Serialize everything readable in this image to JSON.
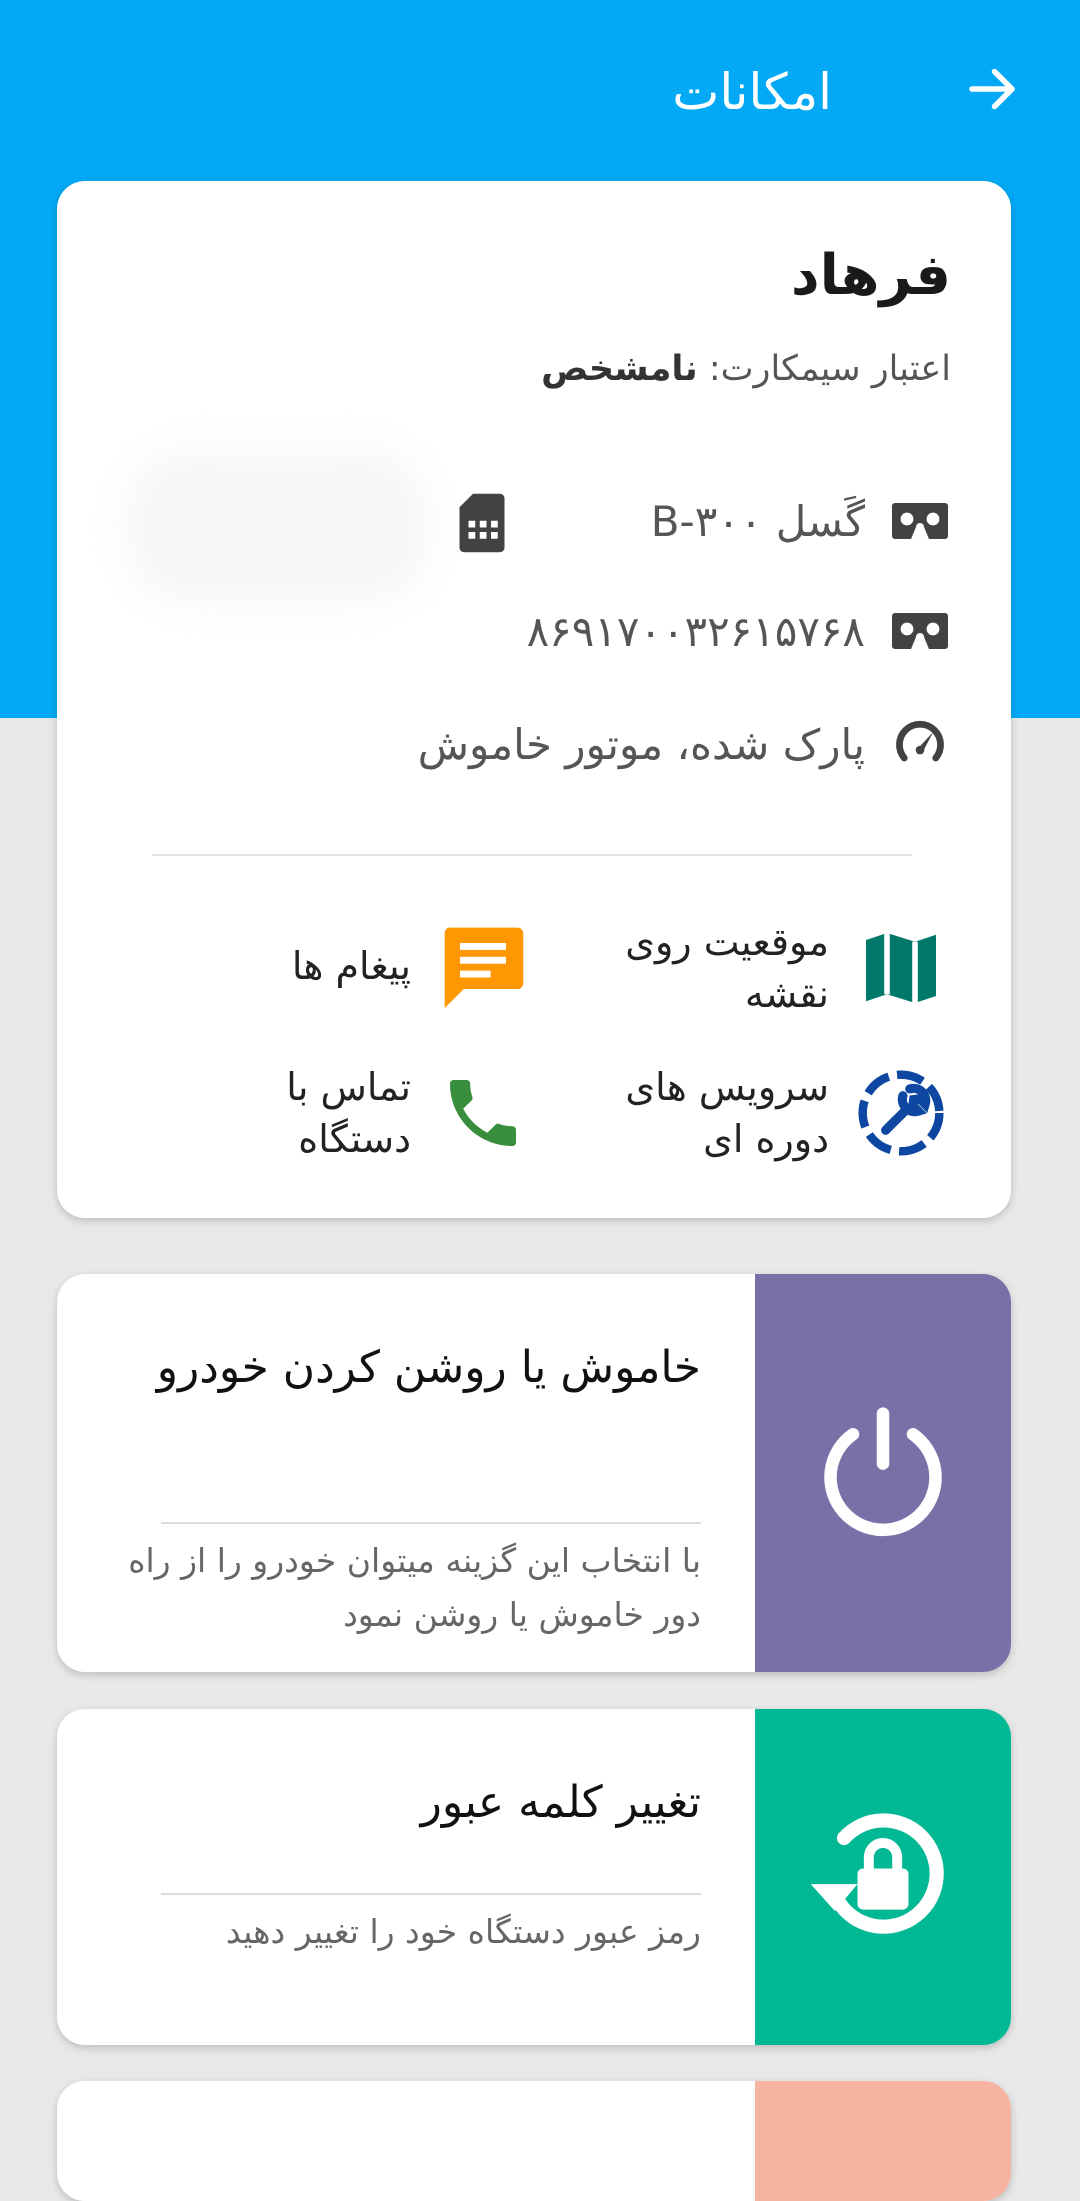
{
  "header": {
    "title": "امکانات"
  },
  "info": {
    "owner": "فرهاد",
    "sim_credit_label": "اعتبار سیمکارت:",
    "sim_credit_value": "نامشخص",
    "model": "گَسل B-۳۰۰",
    "imei": "۸۶۹۱۷۰۰۳۲۶۱۵۷۶۸",
    "status": "پارک شده، موتور خاموش"
  },
  "actions": {
    "map": "موقعیت روی نقشه",
    "messages": "پیغام ها",
    "service": "سرویس های دوره ای",
    "call": "تماس با دستگاه"
  },
  "features": [
    {
      "title": "خاموش یا روشن کردن خودرو",
      "description": "با انتخاب این گزینه میتوان خودرو را از راه دور خاموش یا روشن نمود",
      "color": "#7a70a8",
      "icon": "power-icon"
    },
    {
      "title": "تغییر کلمه عبور",
      "description": "رمز عبور دستگاه خود را تغییر دهید",
      "color": "#00b894",
      "icon": "lock-reset-icon"
    },
    {
      "title": "",
      "description": "",
      "color": "#f7b3a1",
      "icon": ""
    }
  ],
  "colors": {
    "primary": "#03a9f4",
    "map_icon": "#00796b",
    "message_icon": "#ff9800",
    "service_icon": "#0d47a1",
    "call_icon": "#388e3c"
  }
}
